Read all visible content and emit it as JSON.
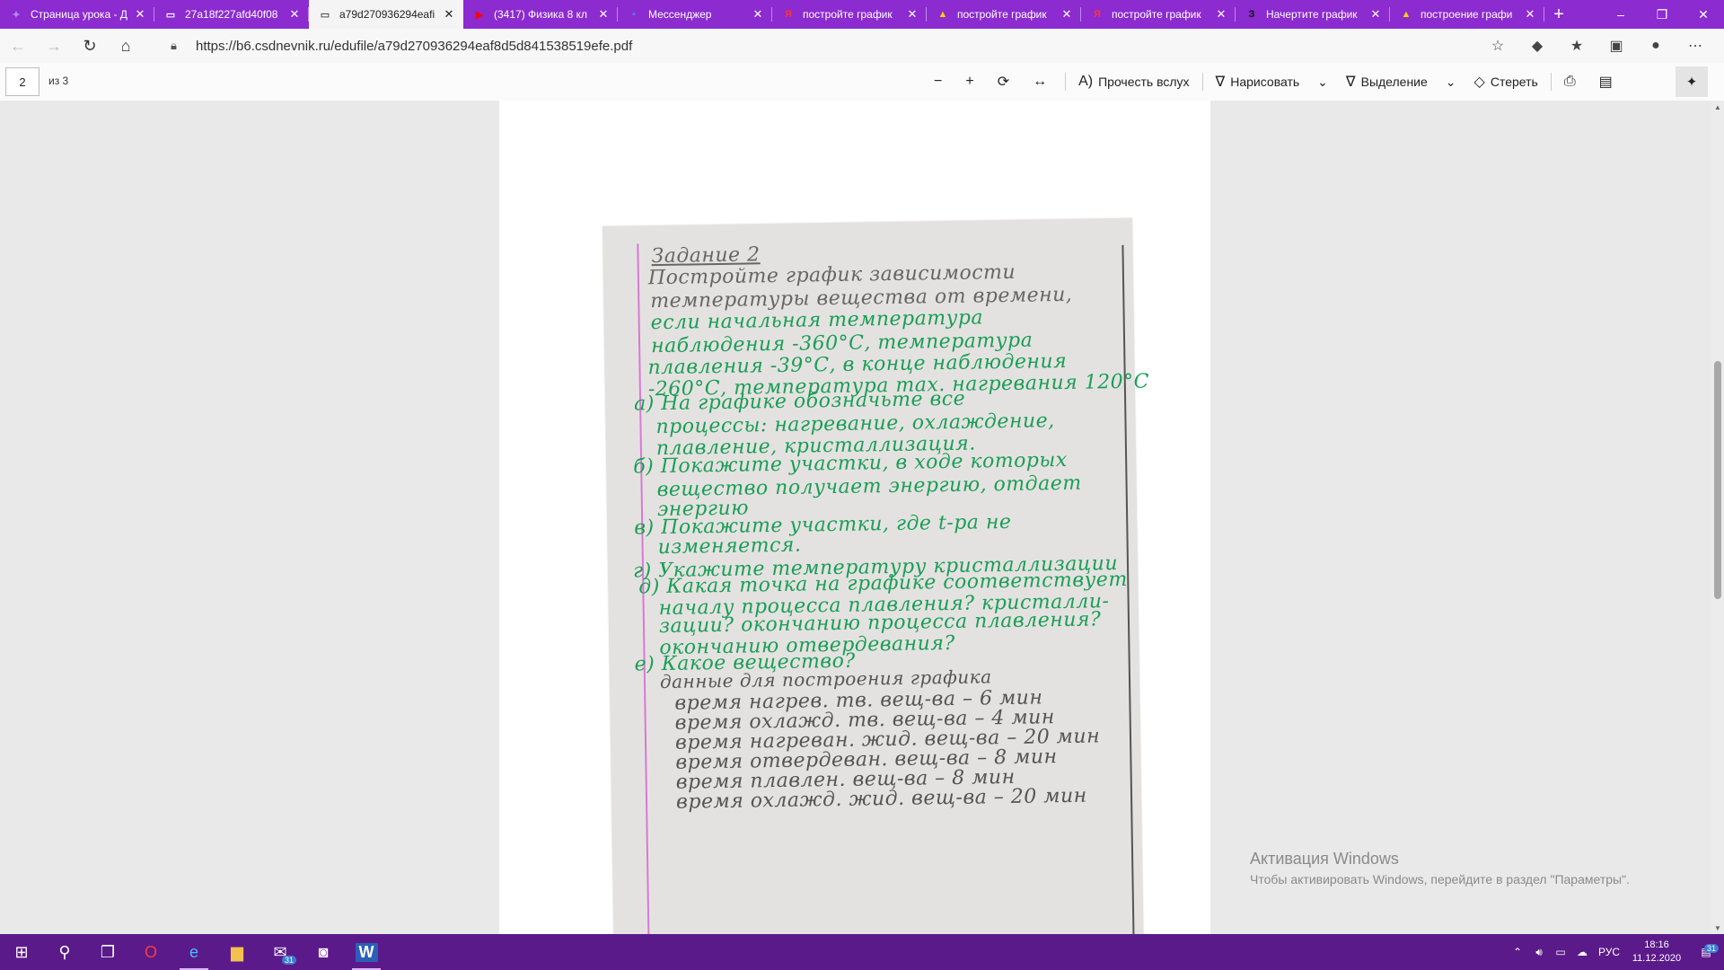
{
  "browser": {
    "tabs": [
      {
        "title": "Страница урока - Д",
        "icon": "lesson-icon",
        "icon_glyph": "✦",
        "icon_color": "#b38cff",
        "active": false
      },
      {
        "title": "27a18f227afd40f08",
        "icon": "file-icon",
        "icon_glyph": "▭",
        "icon_color": "#ffffff",
        "active": false
      },
      {
        "title": "a79d270936294eafi",
        "icon": "file-icon",
        "icon_glyph": "▭",
        "icon_color": "#555555",
        "active": true
      },
      {
        "title": "(3417) Физика 8 кл",
        "icon": "youtube-icon",
        "icon_glyph": "▶",
        "icon_color": "#ff0000",
        "active": false
      },
      {
        "title": "Мессенджер",
        "icon": "messenger-icon",
        "icon_glyph": "▪",
        "icon_color": "#4f7cff",
        "active": false
      },
      {
        "title": "постройте график",
        "icon": "yandex-icon",
        "icon_glyph": "Я",
        "icon_color": "#ff3333",
        "active": false
      },
      {
        "title": "постройте график",
        "icon": "image-icon",
        "icon_glyph": "▲",
        "icon_color": "#ffcc00",
        "active": false
      },
      {
        "title": "постройте график",
        "icon": "yandex-icon",
        "icon_glyph": "Я",
        "icon_color": "#ff3333",
        "active": false
      },
      {
        "title": "Начертите график",
        "icon": "znanija-icon",
        "icon_glyph": "З",
        "icon_color": "#111111",
        "active": false
      },
      {
        "title": "построение графи",
        "icon": "image-icon",
        "icon_glyph": "▲",
        "icon_color": "#ffcc00",
        "active": false
      }
    ],
    "new_tab": "+",
    "url": "https://b6.csdnevnik.ru/edufile/a79d270936294eaf8d5d841538519efe.pdf"
  },
  "pdf_toolbar": {
    "page_current": "2",
    "page_total": "из 3",
    "read_aloud": "Прочесть вслух",
    "draw": "Нарисовать",
    "highlight": "Выделение",
    "erase": "Стереть"
  },
  "document": {
    "lines": [
      {
        "text": "Задание 2",
        "style": "gray"
      },
      {
        "text": "Постройте график зависимости",
        "style": "gray"
      },
      {
        "text": "температуры вещества от времени,",
        "style": "gray"
      },
      {
        "text": "если начальная температура",
        "style": "green"
      },
      {
        "text": "наблюдения -360°С, температура",
        "style": "green"
      },
      {
        "text": "плавления -39°С, в конце наблюдения",
        "style": "green"
      },
      {
        "text": "-260°С, температура max. нагревания 120°С",
        "style": "green"
      },
      {
        "text": "а) На графике обозначьте все",
        "style": "green"
      },
      {
        "text": "процессы: нагревание, охлаждение,",
        "style": "green"
      },
      {
        "text": "плавление, кристаллизация.",
        "style": "green"
      },
      {
        "text": "б) Покажите участки, в ходе которых",
        "style": "green"
      },
      {
        "text": "вещество получает энергию, отдает",
        "style": "green"
      },
      {
        "text": "энергию",
        "style": "green"
      },
      {
        "text": "в) Покажите участки, где t-ра не",
        "style": "green"
      },
      {
        "text": "изменяется.",
        "style": "green"
      },
      {
        "text": "г) Укажите температуру кристаллизации",
        "style": "green"
      },
      {
        "text": "д) Какая точка на графике соответствует",
        "style": "green"
      },
      {
        "text": "началу процесса плавления? кристалли-",
        "style": "green"
      },
      {
        "text": "зации? окончанию процесса плавления?",
        "style": "green"
      },
      {
        "text": "окончанию отвердевания?",
        "style": "green"
      },
      {
        "text": "е) Какое вещество?",
        "style": "green"
      },
      {
        "text": "данные для построения графика",
        "style": "dark"
      },
      {
        "text": "время нагрев. тв. вещ-ва – 6 мин",
        "style": "dark"
      },
      {
        "text": "время охлажд. тв. вещ-ва – 4 мин",
        "style": "dark"
      },
      {
        "text": "время нагреван. жид. вещ-ва – 20 мин",
        "style": "dark"
      },
      {
        "text": "время отвердеван. вещ-ва – 8 мин",
        "style": "dark"
      },
      {
        "text": "время плавлен. вещ-ва – 8 мин",
        "style": "dark"
      },
      {
        "text": "время охлажд. жид. вещ-ва – 20 мин",
        "style": "dark"
      }
    ]
  },
  "watermark": {
    "title": "Активация Windows",
    "subtitle": "Чтобы активировать Windows, перейдите в раздел \"Параметры\"."
  },
  "taskbar": {
    "items": [
      {
        "name": "start-button",
        "glyph": "⊞"
      },
      {
        "name": "search-taskbar-button",
        "glyph": "⚲"
      },
      {
        "name": "task-view-button",
        "glyph": "❐"
      },
      {
        "name": "opera-icon",
        "glyph": "O"
      },
      {
        "name": "edge-icon",
        "glyph": "e"
      },
      {
        "name": "file-explorer-icon",
        "glyph": "▆"
      },
      {
        "name": "mail-icon",
        "glyph": "✉"
      },
      {
        "name": "discord-icon",
        "glyph": "◙"
      },
      {
        "name": "word-icon",
        "glyph": "W"
      }
    ],
    "mail_badge": "31",
    "language": "РУС",
    "time": "18:16",
    "date": "11.12.2020",
    "notification_badge": "31"
  }
}
